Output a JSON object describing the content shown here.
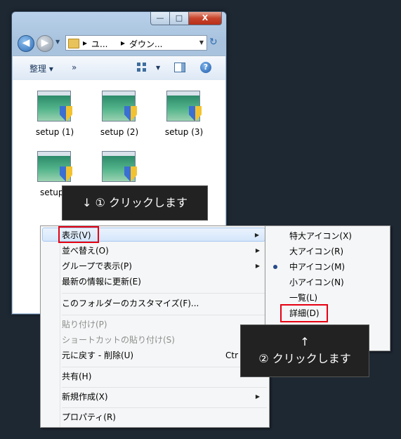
{
  "window": {
    "address": {
      "crumb1": "ユ...",
      "crumb2": "ダウン..."
    },
    "controls": {
      "minimize": "—",
      "maximize": "□",
      "close": "X"
    },
    "nav": {
      "back": "◀",
      "forward": "▶"
    },
    "toolbar": {
      "organize": "整理",
      "more": "»",
      "help": "?"
    }
  },
  "files": [
    {
      "label": "setup (1)"
    },
    {
      "label": "setup (2)"
    },
    {
      "label": "setup (3)"
    },
    {
      "label": "setup ("
    },
    {
      "label": ""
    }
  ],
  "context_menu": {
    "items": [
      {
        "label": "表示(V)",
        "submenu": true,
        "highlighted": true
      },
      {
        "label": "並べ替え(O)",
        "submenu": true
      },
      {
        "label": "グループで表示(P)",
        "submenu": true
      },
      {
        "label": "最新の情報に更新(E)"
      },
      {
        "label": "このフォルダーのカスタマイズ(F)..."
      },
      {
        "label": "貼り付け(P)",
        "disabled": true
      },
      {
        "label": "ショートカットの貼り付け(S)",
        "disabled": true
      },
      {
        "label": "元に戻す - 削除(U)",
        "shortcut": "Ctr"
      },
      {
        "label": "共有(H)",
        "submenu": true
      },
      {
        "label": "新規作成(X)",
        "submenu": true
      },
      {
        "label": "プロパティ(R)"
      }
    ]
  },
  "view_submenu": {
    "items": [
      {
        "label": "特大アイコン(X)"
      },
      {
        "label": "大アイコン(R)"
      },
      {
        "label": "中アイコン(M)",
        "selected": true
      },
      {
        "label": "小アイコン(N)"
      },
      {
        "label": "一覧(L)"
      },
      {
        "label": "詳細(D)"
      }
    ]
  },
  "callouts": {
    "step1": "↓ ① クリックします",
    "step2_arrow": "↑",
    "step2": "② クリックします"
  },
  "colors": {
    "highlight_box": "#e60012",
    "callout_bg": "#222222"
  }
}
